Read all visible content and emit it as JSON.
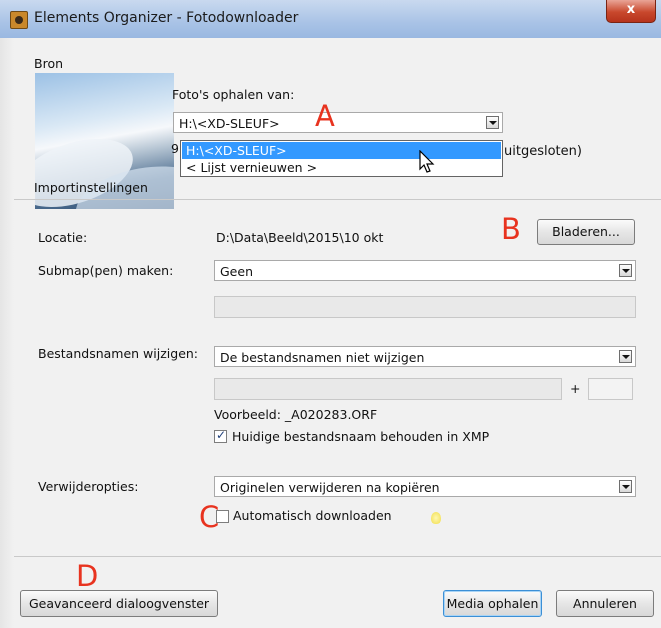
{
  "window": {
    "title": "Elements Organizer - Fotodownloader",
    "close_glyph": "x"
  },
  "source": {
    "heading": "Bron",
    "import_settings_label": "Importinstellingen",
    "get_from_label": "Foto's ophalen van:",
    "get_from_value": "H:\\<XD-SLEUF>",
    "hidden_text_left": "9",
    "hidden_text_right": "uitgesloten)",
    "dropdown_options": [
      "H:\\<XD-SLEUF>",
      "< Lijst vernieuwen >"
    ],
    "selected_option_index": 0
  },
  "location": {
    "label": "Locatie:",
    "value": "D:\\Data\\Beeld\\2015\\10 okt",
    "browse_button": "Bladeren..."
  },
  "subfolder": {
    "label": "Submap(pen) maken:",
    "value": "Geen",
    "custom_value": ""
  },
  "rename": {
    "label": "Bestandsnamen wijzigen:",
    "value": "De bestandsnamen niet wijzigen",
    "name_value": "",
    "plus": "+",
    "suffix_value": "",
    "example": "Voorbeeld: _A020283.ORF",
    "keep_name_label": "Huidige bestandsnaam behouden in XMP",
    "keep_name_checked": true
  },
  "delete": {
    "label": "Verwijderopties:",
    "value": "Originelen verwijderen na kopiëren",
    "auto_download_label": "Automatisch downloaden",
    "auto_download_checked": false
  },
  "buttons": {
    "advanced": "Geavanceerd dialoogvenster",
    "get_media": "Media ophalen",
    "cancel": "Annuleren"
  },
  "annotations": {
    "a": "A",
    "b": "B",
    "c": "C",
    "d": "D",
    "color": "#e8331f"
  },
  "icons": {
    "app": "organizer-app-icon",
    "tip": "lightbulb-icon",
    "pointer": "mouse-cursor-icon"
  }
}
